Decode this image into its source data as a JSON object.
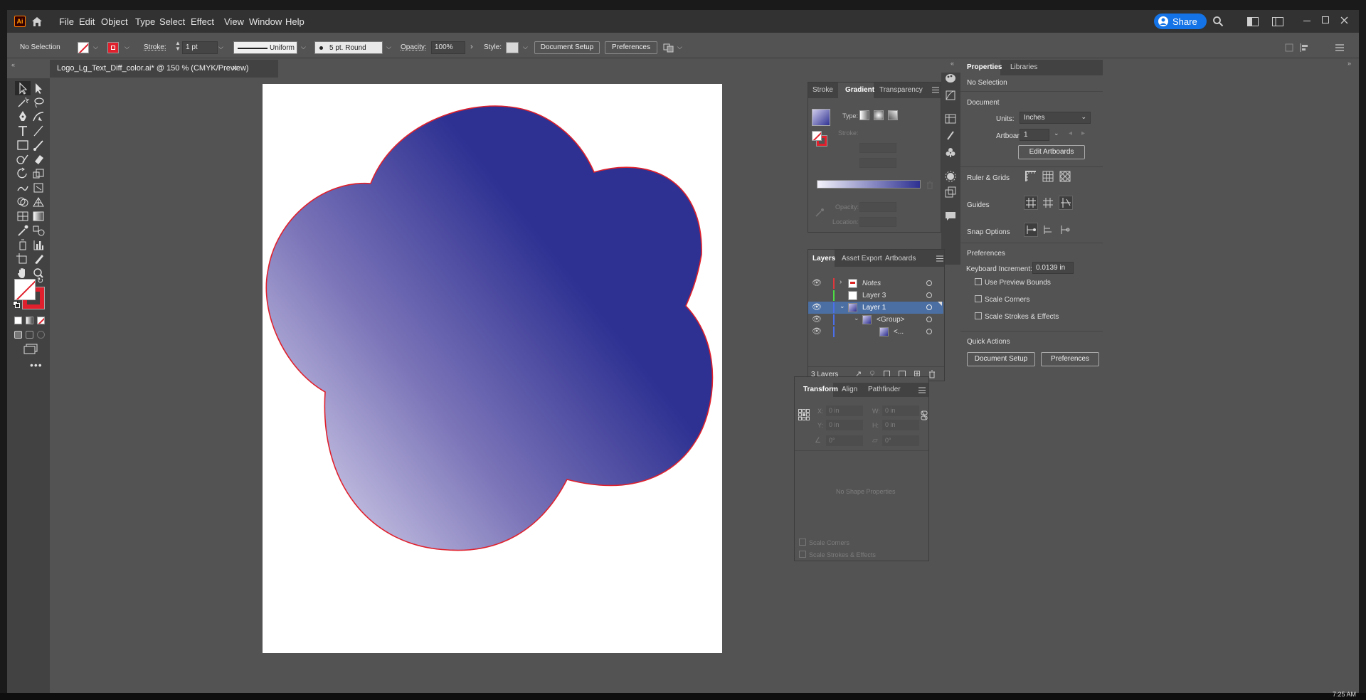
{
  "app": {
    "badge": "Ai",
    "home_icon": "home-icon"
  },
  "menu": [
    "File",
    "Edit",
    "Object",
    "Type",
    "Select",
    "Effect",
    "View",
    "Window",
    "Help"
  ],
  "share": {
    "label": "Share"
  },
  "control": {
    "selection": "No Selection",
    "stroke_label": "Stroke:",
    "stroke_weight": "1 pt",
    "profile": "Uniform",
    "brush": "5 pt. Round",
    "opacity_label": "Opacity:",
    "opacity": "100%",
    "style_label": "Style:",
    "doc_setup": "Document Setup",
    "preferences": "Preferences"
  },
  "doc": {
    "title": "Logo_Lg_Text_Diff_color.ai* @ 150 % (CMYK/Preview)",
    "close": "×"
  },
  "gradient_panel": {
    "tabs": [
      "Stroke",
      "Gradient",
      "Transparency"
    ],
    "type_label": "Type:",
    "stroke_label": "Stroke:",
    "opacity_label": "Opacity:",
    "location_label": "Location:",
    "colors": {
      "start": "#c4c0e0",
      "end": "#2e3192"
    }
  },
  "layers_panel": {
    "tabs": [
      "Layers",
      "Asset Export",
      "Artboards"
    ],
    "layers": [
      {
        "name": "Notes",
        "color": "#e0363c",
        "eye": true
      },
      {
        "name": "Layer 3",
        "color": "#4cdc44",
        "eye": false
      },
      {
        "name": "Layer 1",
        "color": "#4a6fe8",
        "eye": true
      },
      {
        "name": "<Group>",
        "color": "#4a6fe8",
        "eye": true
      },
      {
        "name": "<...",
        "color": "#4a6fe8",
        "eye": true
      }
    ],
    "count": "3 Layers"
  },
  "transform_panel": {
    "tabs": [
      "Transform",
      "Align",
      "Pathfinder"
    ],
    "x_label": "X:",
    "x": "0 in",
    "y_label": "Y:",
    "y": "0 in",
    "w_label": "W:",
    "w": "0 in",
    "h_label": "H:",
    "h": "0 in",
    "angle": "0°",
    "shear": "0°",
    "no_shape": "No Shape Properties",
    "scale_corners": "Scale Corners",
    "scale_strokes": "Scale Strokes & Effects"
  },
  "properties": {
    "tabs": [
      "Properties",
      "Libraries"
    ],
    "selection": "No Selection",
    "document": "Document",
    "units_label": "Units:",
    "units": "Inches",
    "artboard_label": "Artboard:",
    "artboard": "1",
    "edit_artboards": "Edit Artboards",
    "ruler_grids": "Ruler & Grids",
    "guides": "Guides",
    "snap": "Snap Options",
    "prefs": "Preferences",
    "kb_label": "Keyboard Increment:",
    "kb_value": "0.0139 in",
    "use_preview": "Use Preview Bounds",
    "scale_corners": "Scale Corners",
    "scale_strokes": "Scale Strokes & Effects",
    "quick_actions": "Quick Actions",
    "doc_setup": "Document Setup",
    "preferences": "Preferences"
  },
  "taskbar": {
    "time": "7:25 AM"
  }
}
